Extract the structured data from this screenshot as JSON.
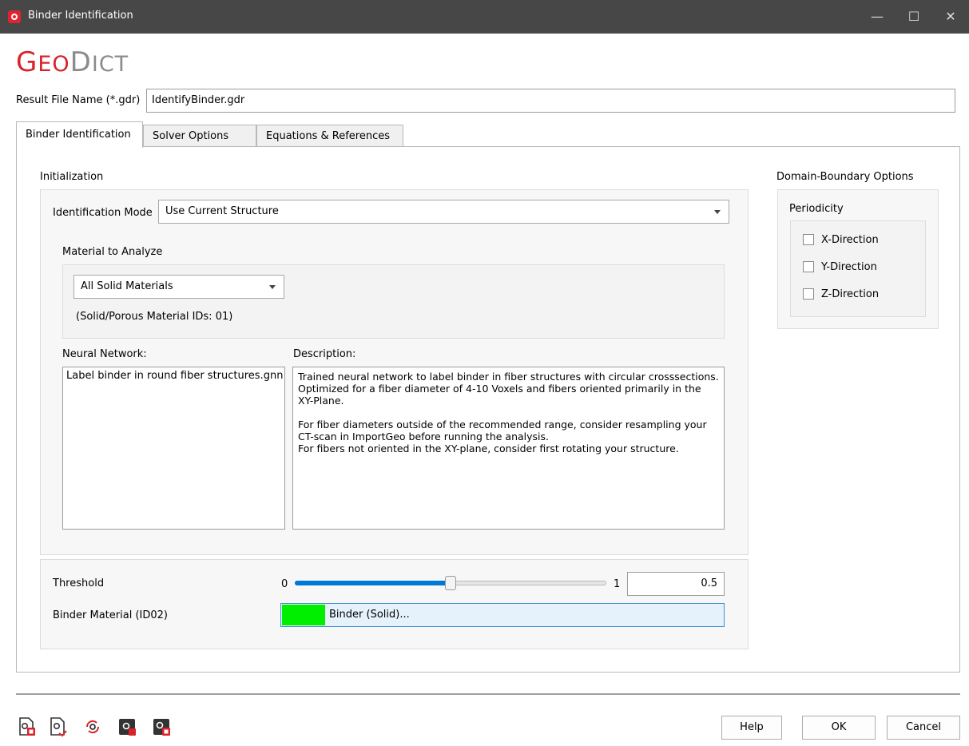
{
  "window": {
    "title": "Binder Identification",
    "close_glyph": "✕",
    "max_glyph": "☐",
    "min_glyph": "—"
  },
  "logo": {
    "g": "G",
    "eo": "EO",
    "d": "D",
    "ict": "ICT"
  },
  "result_file": {
    "label": "Result File Name (*.gdr)",
    "value": "IdentifyBinder.gdr"
  },
  "tabs": [
    {
      "label": "Binder Identification",
      "active": true
    },
    {
      "label": "Solver Options",
      "active": false
    },
    {
      "label": "Equations & References",
      "active": false
    }
  ],
  "initialization": {
    "title": "Initialization",
    "identification_mode_label": "Identification Mode",
    "identification_mode_value": "Use Current Structure",
    "material_to_analyze_label": "Material to Analyze",
    "material_value": "All Solid Materials",
    "material_ids_note": "(Solid/Porous Material IDs: 01)",
    "neural_network_label": "Neural Network:",
    "neural_network_items": [
      "Label binder in round fiber structures.gnn"
    ],
    "description_label": "Description:",
    "description_lines": [
      "Trained neural network to label binder in fiber structures with circular crosssections.",
      "Optimized for a fiber diameter of 4-10 Voxels and fibers oriented primarily in the XY-Plane.",
      "",
      "For fiber diameters outside of the recommended range, consider resampling your CT-scan in ImportGeo before running the analysis.",
      "For fibers not oriented in the XY-plane, consider first rotating your structure."
    ]
  },
  "threshold": {
    "label": "Threshold",
    "min_label": "0",
    "max_label": "1",
    "value": "0.5",
    "fraction": 0.5
  },
  "binder_material": {
    "label": "Binder Material (ID02)",
    "button_text": "Binder (Solid)...",
    "color": "#00ee00"
  },
  "domain_boundary": {
    "title": "Domain-Boundary Options",
    "periodicity_label": "Periodicity",
    "directions": [
      {
        "label": "X-Direction",
        "checked": false
      },
      {
        "label": "Y-Direction",
        "checked": false
      },
      {
        "label": "Z-Direction",
        "checked": false
      }
    ]
  },
  "footer": {
    "help": "Help",
    "ok": "OK",
    "cancel": "Cancel"
  },
  "toolbar_icons": [
    "load-settings-icon",
    "save-settings-icon",
    "reset-settings-icon",
    "macro-record-icon",
    "macro-export-icon"
  ],
  "colors": {
    "accent": "#0078d7",
    "brand_red": "#d8232a",
    "titlebar": "#474747"
  }
}
